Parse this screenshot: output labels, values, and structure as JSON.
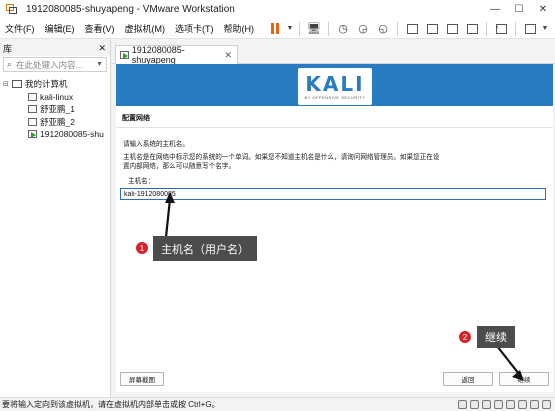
{
  "window": {
    "title": "1912080085-shuyapeng - VMware Workstation",
    "minimize": "—",
    "maximize": "☐",
    "close": "✕"
  },
  "menu": [
    "文件(F)",
    "编辑(E)",
    "查看(V)",
    "虚拟机(M)",
    "选项卡(T)",
    "帮助(H)"
  ],
  "library": {
    "title": "库",
    "close": "✕",
    "search_placeholder": "在此处键入内容...",
    "tree": [
      {
        "label": "我的计算机",
        "type": "root"
      },
      {
        "label": "kali-linux",
        "type": "vm"
      },
      {
        "label": "舒亚鹏_1",
        "type": "vm"
      },
      {
        "label": "舒亚鹏_2",
        "type": "vm"
      },
      {
        "label": "1912080085-shu",
        "type": "vm-running"
      }
    ]
  },
  "tab": {
    "label": "1912080085-shuyapeng",
    "close": "✕"
  },
  "installer": {
    "logo": "KALI",
    "logo_sub": "BY OFFENSIVE SECURITY",
    "page_title": "配置网络",
    "prompt": "请输入系统的主机名。",
    "description": "主机名是在网络中标示您的系统的一个单词。如果您不知道主机名是什么，请询问网络管理员。如果您正在设置内部网络，那么可以随意写个名字。",
    "hostname_label": "主机名：",
    "hostname_value": "kali-1912080085",
    "btn_screenshot": "屏幕截图",
    "btn_back": "返回",
    "btn_continue": "继续"
  },
  "annotations": {
    "one": {
      "num": "1",
      "text": "主机名（用户名）"
    },
    "two": {
      "num": "2",
      "text": "继续"
    }
  },
  "status": {
    "text": "要将输入定向到该虚拟机，请在虚拟机内部单击或按 Ctrl+G。"
  },
  "colors": {
    "kali_blue": "#297bc2",
    "pause_orange": "#e8650e",
    "annotation_red": "#d9232a",
    "annotation_bg": "#4c4c4c"
  }
}
